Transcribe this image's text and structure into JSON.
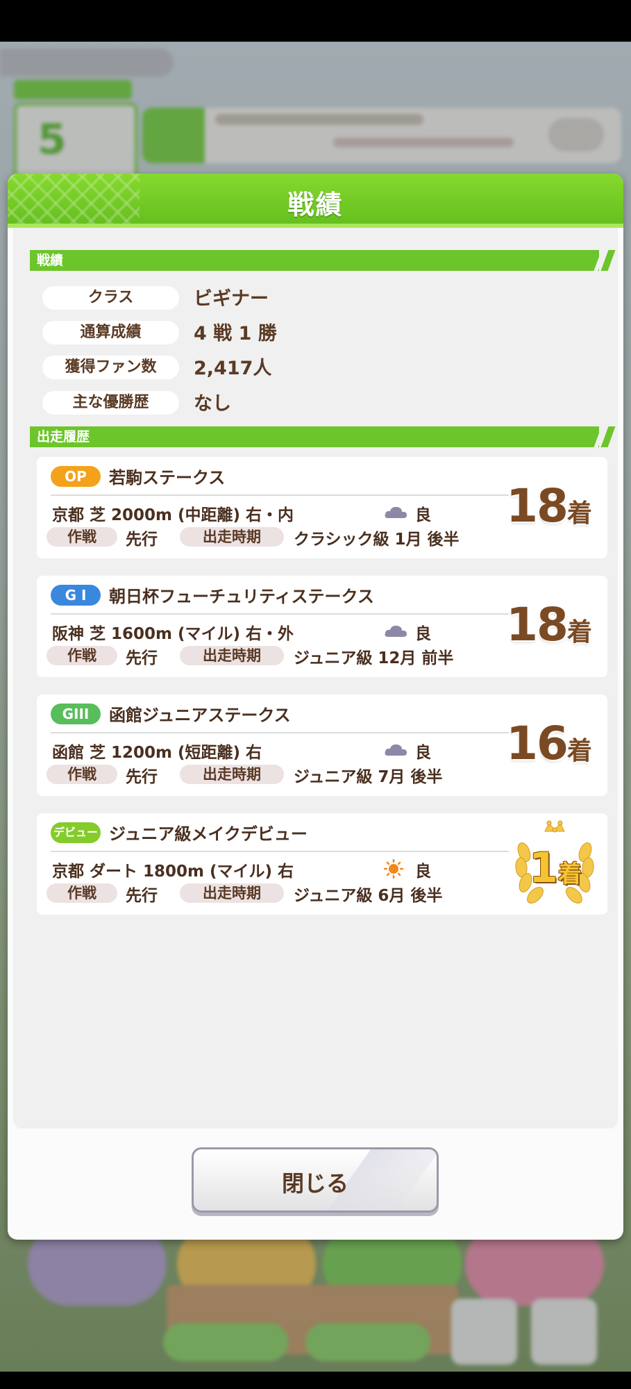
{
  "dialog": {
    "title": "戦績",
    "close_label": "閉じる"
  },
  "sections": {
    "record": "戦績",
    "history": "出走履歴"
  },
  "stats": [
    {
      "label": "クラス",
      "value": "ビギナー"
    },
    {
      "label": "通算成績",
      "value": "4 戦 1 勝"
    },
    {
      "label": "獲得ファン数",
      "value": "2,417人"
    },
    {
      "label": "主な優勝歴",
      "value": "なし"
    }
  ],
  "races": [
    {
      "grade": "OP",
      "grade_color": "#f4a21b",
      "name": "若駒ステークス",
      "course": "京都 芝 2000m (中距離) 右・内",
      "weather_icon": "cloud-icon",
      "condition": "良",
      "tactic_label": "作戦",
      "tactic": "先行",
      "period_label": "出走時期",
      "period": "クラシック級 1月 後半",
      "place_num": "18",
      "place_suffix": "着"
    },
    {
      "grade": "G I",
      "grade_color": "#3a87de",
      "name": "朝日杯フューチュリティステークス",
      "course": "阪神 芝 1600m (マイル) 右・外",
      "weather_icon": "cloud-icon",
      "condition": "良",
      "tactic_label": "作戦",
      "tactic": "先行",
      "period_label": "出走時期",
      "period": "ジュニア級 12月 前半",
      "place_num": "18",
      "place_suffix": "着"
    },
    {
      "grade": "GIII",
      "grade_color": "#58bd5b",
      "name": "函館ジュニアステークス",
      "course": "函館 芝 1200m (短距離) 右",
      "weather_icon": "cloud-icon",
      "condition": "良",
      "tactic_label": "作戦",
      "tactic": "先行",
      "period_label": "出走時期",
      "period": "ジュニア級 7月 後半",
      "place_num": "16",
      "place_suffix": "着"
    },
    {
      "grade": "デビュー",
      "grade_color": "#84cc2b",
      "name": "ジュニア級メイクデビュー",
      "course": "京都 ダート 1800m (マイル) 右",
      "weather_icon": "sun-icon",
      "condition": "良",
      "tactic_label": "作戦",
      "tactic": "先行",
      "period_label": "出走時期",
      "period": "ジュニア級 6月 後半",
      "place_num": "1",
      "place_suffix": "着"
    }
  ],
  "background": {
    "turn_number": "5"
  }
}
